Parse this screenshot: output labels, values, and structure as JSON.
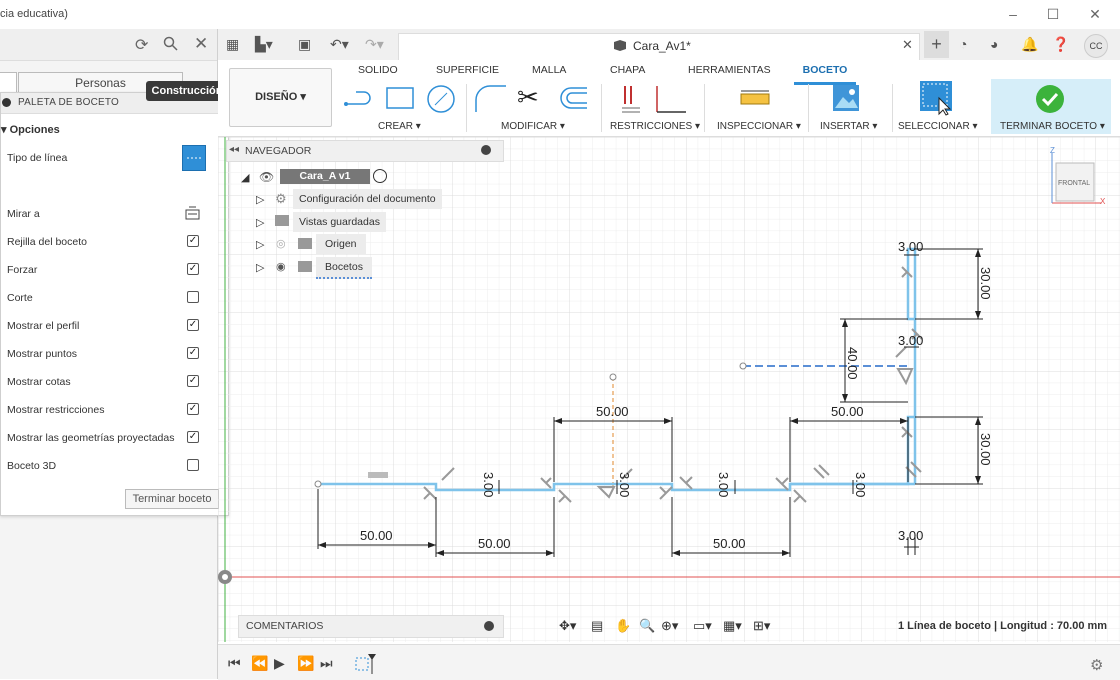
{
  "window": {
    "title_fragment": "cia educativa)",
    "controls": [
      "–",
      "☐",
      "✕"
    ]
  },
  "left_panel": {
    "tab_label": "Personas",
    "palette": {
      "title": "PALETA DE BOCETO",
      "section": "▾ Opciones",
      "line_type_label": "Tipo de línea",
      "tooltip": "Construcción",
      "options": [
        {
          "label": "Mirar a",
          "checked": null
        },
        {
          "label": "Rejilla del boceto",
          "checked": true
        },
        {
          "label": "Forzar",
          "checked": true
        },
        {
          "label": "Corte",
          "checked": false
        },
        {
          "label": "Mostrar el perfil",
          "checked": true
        },
        {
          "label": "Mostrar puntos",
          "checked": true
        },
        {
          "label": "Mostrar cotas",
          "checked": true
        },
        {
          "label": "Mostrar restricciones",
          "checked": true
        },
        {
          "label": "Mostrar las geometrías proyectadas",
          "checked": true
        },
        {
          "label": "Boceto 3D",
          "checked": false
        }
      ],
      "finish_button": "Terminar boceto"
    }
  },
  "document": {
    "title": "Cara_Av1*"
  },
  "ribbon": {
    "workspace": "DISEÑO ▾",
    "tabs": [
      "SOLIDO",
      "SUPERFICIE",
      "MALLA",
      "CHAPA",
      "HERRAMIENTAS",
      "BOCETO"
    ],
    "groups": [
      "CREAR ▾",
      "MODIFICAR ▾",
      "RESTRICCIONES ▾",
      "INSPECCIONAR ▾",
      "INSERTAR ▾",
      "SELECCIONAR ▾",
      "TERMINAR BOCETO ▾"
    ]
  },
  "navigator": {
    "title": "NAVEGADOR",
    "root": "Cara_A v1",
    "items": [
      "Configuración del documento",
      "Vistas guardadas",
      "Origen",
      "Bocetos"
    ]
  },
  "viewcube": {
    "face": "FRONTAL",
    "axis_z": "Z",
    "axis_x": "X"
  },
  "dimensions": {
    "d50_a": "50.00",
    "d50_b": "50.00",
    "d50_c": "50.00",
    "d50_top1": "50.00",
    "d50_top2": "50.00",
    "d3_top": "3.00",
    "d3_mid": "3.00",
    "d3_bot": "3.00",
    "d30_top": "30.00",
    "d30_bot": "30.00",
    "d40": "40.00",
    "d3_v1": "3.00",
    "d3_v2": "3.00",
    "d3_v3": "3.00",
    "d3_v4": "3.00"
  },
  "bottom": {
    "comments": "COMENTARIOS",
    "status": "1 Línea de boceto | Longitud : 70.00 mm"
  },
  "colors": {
    "accent": "#2f8fd7",
    "sketch_line": "#7fc3ea",
    "dimension": "#000000",
    "axis_red": "#e05050",
    "axis_green": "#40b040",
    "construction": "#e08a2e"
  }
}
